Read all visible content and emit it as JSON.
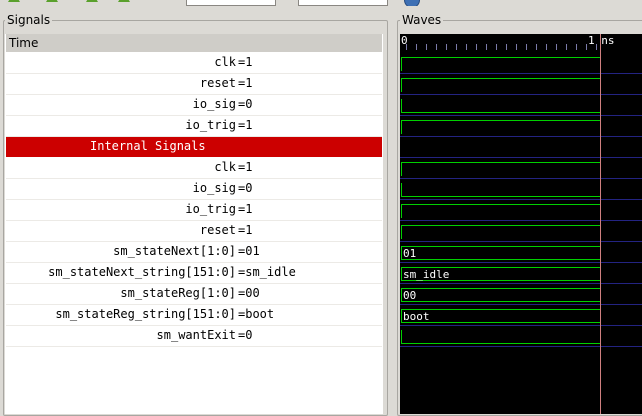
{
  "colors": {
    "wave_line": "#00d000",
    "group_highlight": "#cc0000",
    "grid_line": "#232382",
    "wave_bg": "#000000"
  },
  "signals_panel": {
    "title": "Signals",
    "header": "Time",
    "rows": [
      {
        "name": "clk",
        "value": "=1"
      },
      {
        "name": "reset",
        "value": "=1"
      },
      {
        "name": "io_sig",
        "value": "=0"
      },
      {
        "name": "io_trig",
        "value": "=1"
      }
    ],
    "group_label": "Internal Signals",
    "internal_rows": [
      {
        "name": "clk",
        "value": "=1"
      },
      {
        "name": "io_sig",
        "value": "=0"
      },
      {
        "name": "io_trig",
        "value": "=1"
      },
      {
        "name": "reset",
        "value": "=1"
      },
      {
        "name": "sm_stateNext[1:0]",
        "value": "=01"
      },
      {
        "name": "sm_stateNext_string[151:0]",
        "value": "=sm_idle"
      },
      {
        "name": "sm_stateReg[1:0]",
        "value": "=00"
      },
      {
        "name": "sm_stateReg_string[151:0]",
        "value": "=boot"
      },
      {
        "name": "sm_wantExit",
        "value": "=0"
      }
    ]
  },
  "waves_panel": {
    "title": "Waves",
    "ruler_start": "0",
    "ruler_end": "1 ns",
    "traces": [
      {
        "kind": "bit",
        "level": 1
      },
      {
        "kind": "bit",
        "level": 1
      },
      {
        "kind": "bit",
        "level": 0
      },
      {
        "kind": "bit",
        "level": 1
      },
      {
        "kind": "group"
      },
      {
        "kind": "bit",
        "level": 1
      },
      {
        "kind": "bit",
        "level": 0
      },
      {
        "kind": "bit",
        "level": 1
      },
      {
        "kind": "bit",
        "level": 1
      },
      {
        "kind": "vector",
        "text": "01"
      },
      {
        "kind": "vector",
        "text": "sm_idle"
      },
      {
        "kind": "vector",
        "text": "00"
      },
      {
        "kind": "vector",
        "text": "boot"
      },
      {
        "kind": "bit",
        "level": 0
      }
    ]
  }
}
